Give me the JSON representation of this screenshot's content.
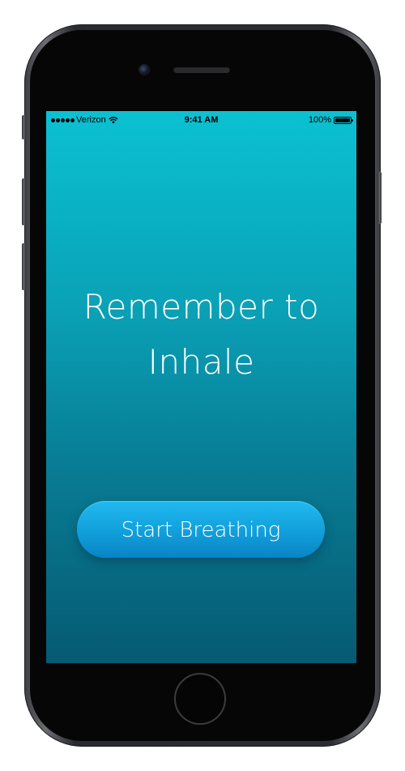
{
  "status_bar": {
    "carrier": "Verizon",
    "time": "9:41 AM",
    "battery": "100%",
    "signal_icon": "signal-dots-icon",
    "wifi_icon": "wifi-icon",
    "battery_icon": "battery-icon"
  },
  "main": {
    "headline_line1": "Remember to",
    "headline_line2": "Inhale",
    "start_button_label": "Start Breathing"
  },
  "colors": {
    "gradient_top": "#0bc1d2",
    "gradient_bottom": "#065a72",
    "button": "#119fda",
    "text": "#ffffff"
  }
}
